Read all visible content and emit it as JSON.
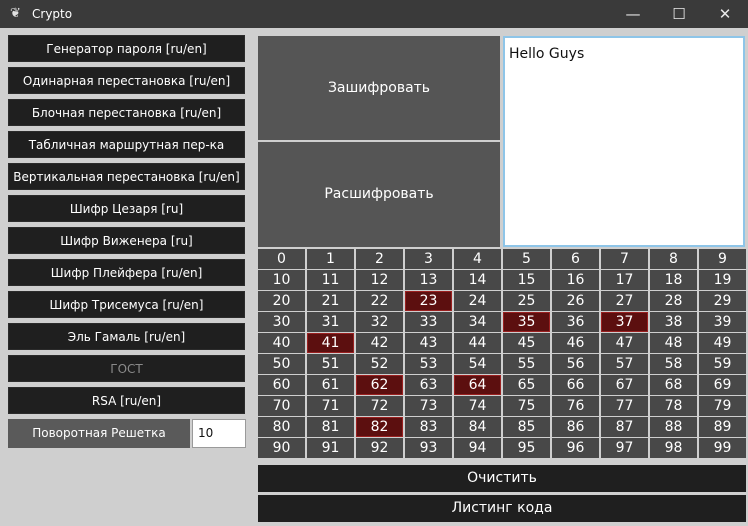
{
  "window": {
    "title": "Crypto",
    "app_icon": "feather-icon",
    "controls": {
      "minimize": "—",
      "maximize": "☐",
      "close": "✕"
    }
  },
  "sidebar": {
    "buttons": [
      "Генератор пароля [ru/en]",
      "Одинарная перестановка [ru/en]",
      "Блочная перестановка [ru/en]",
      "Табличная маршрутная пер-ка [ru/en]",
      "Вертикальная перестановка [ru/en]",
      "Шифр Цезаря [ru]",
      "Шифр Виженера [ru]",
      "Шифр Плейфера [ru/en]",
      "Шифр Трисемуса [ru/en]",
      "Эль Гамаль [ru/en]",
      "ГОСТ",
      "RSA [ru/en]"
    ],
    "disabled_index": 10,
    "rotating_grid": {
      "label": "Поворотная Решетка",
      "value": "10"
    }
  },
  "main": {
    "encrypt_label": "Зашифровать",
    "decrypt_label": "Расшифровать",
    "text": "Hello Guys",
    "grid": {
      "numbers": [
        0,
        1,
        2,
        3,
        4,
        5,
        6,
        7,
        8,
        9,
        10,
        11,
        12,
        13,
        14,
        15,
        16,
        17,
        18,
        19,
        20,
        21,
        22,
        23,
        24,
        25,
        26,
        27,
        28,
        29,
        30,
        31,
        32,
        33,
        34,
        35,
        36,
        37,
        38,
        39,
        40,
        41,
        42,
        43,
        44,
        45,
        46,
        47,
        48,
        49,
        50,
        51,
        52,
        53,
        54,
        55,
        56,
        57,
        58,
        59,
        60,
        61,
        62,
        63,
        64,
        65,
        66,
        67,
        68,
        69,
        70,
        71,
        72,
        73,
        74,
        75,
        76,
        77,
        78,
        79,
        80,
        81,
        82,
        83,
        84,
        85,
        86,
        87,
        88,
        89,
        90,
        91,
        92,
        93,
        94,
        95,
        96,
        97,
        98,
        99
      ],
      "highlighted": [
        23,
        35,
        37,
        41,
        62,
        64,
        82
      ]
    },
    "clear_label": "Очистить",
    "listing_label": "Листинг кода"
  },
  "colors": {
    "highlight": "#5c0f0f",
    "cell": "#484848",
    "button_dark": "#1f1f1f"
  }
}
